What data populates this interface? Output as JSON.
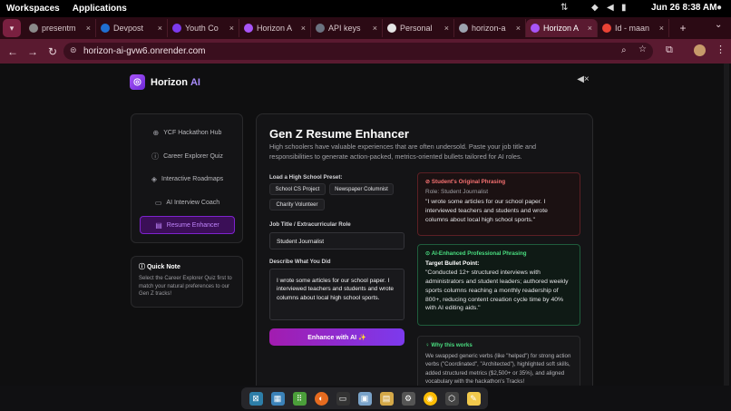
{
  "system_bar": {
    "workspaces": "Workspaces",
    "applications": "Applications",
    "clock": "Jun 26  8:38 AM"
  },
  "tabs": [
    {
      "label": "presentm",
      "color": "#8a8a8a",
      "active": false
    },
    {
      "label": "Devpost",
      "color": "#1f6fd1",
      "active": false
    },
    {
      "label": "Youth Co",
      "color": "#7c3aed",
      "active": false
    },
    {
      "label": "Horizon A",
      "color": "#a855f7",
      "active": false
    },
    {
      "label": "API keys",
      "color": "#6b7280",
      "active": false
    },
    {
      "label": "Personal",
      "color": "#e5e5e5",
      "active": false
    },
    {
      "label": "horizon-a",
      "color": "#9ca3af",
      "active": false
    },
    {
      "label": "Horizon A",
      "color": "#a855f7",
      "active": true
    },
    {
      "label": "Id - maan",
      "color": "#ea4335",
      "active": false
    }
  ],
  "address_bar": {
    "url": "horizon-ai-gvw6.onrender.com"
  },
  "app": {
    "brand_name": "Horizon",
    "brand_suffix": "AI"
  },
  "sidebar": {
    "items": [
      {
        "label": "YCF Hackathon Hub",
        "icon": "globe-icon"
      },
      {
        "label": "Career Explorer Quiz",
        "icon": "info-icon"
      },
      {
        "label": "Interactive Roadmaps",
        "icon": "layers-icon"
      },
      {
        "label": "AI Interview Coach",
        "icon": "chat-icon"
      },
      {
        "label": "Resume Enhancer",
        "icon": "document-icon"
      }
    ],
    "active_index": 4
  },
  "quick_note": {
    "title": "Quick Note",
    "text": "Select the Career Explorer Quiz first to match your natural preferences to our Gen Z tracks!"
  },
  "enhancer": {
    "title": "Gen Z Resume Enhancer",
    "subtitle": "High schoolers have valuable experiences that are often undersold. Paste your job title and responsibilities to generate action-packed, metrics-oriented bullets tailored for AI roles.",
    "preset_label": "Load a High School Preset:",
    "presets": [
      "School CS Project",
      "Newspaper Columnist",
      "Charity Volunteer"
    ],
    "job_title_label": "Job Title / Extracurricular Role",
    "job_title_value": "Student Journalist",
    "did_label": "Describe What You Did",
    "did_value": "I wrote some articles for our school paper. I interviewed teachers and students and wrote columns about local high school sports.",
    "enhance_button": "Enhance with AI ✨"
  },
  "original_card": {
    "title": "Student's Original Phrasing",
    "role": "Role: Student Journalist",
    "quote": "\"I wrote some articles for our school paper. I interviewed teachers and students and wrote columns about local high school sports.\""
  },
  "enhanced_card": {
    "title": "AI-Enhanced Professional Phrasing",
    "target_label": "Target Bullet Point:",
    "quote": "\"Conducted 12+ structured interviews with administrators and student leaders; authored weekly sports columns reaching a monthly readership of 800+, reducing content creation cycle time by 40% with AI editing aids.\""
  },
  "why_card": {
    "title": "Why this works",
    "text": "We swapped generic verbs (like \"helped\") for strong action verbs (\"Coordinated\", \"Architected\"), highlighted soft skills, added structured metrics ($2,500+ or 35%), and aligned vocabulary with the hackathon's Tracks!"
  },
  "colors": {
    "accent": "#a855f7",
    "red": "#ef4444",
    "green": "#22c55e",
    "tab_strip": "#2b0a14",
    "toolbar": "#5a1a30"
  }
}
